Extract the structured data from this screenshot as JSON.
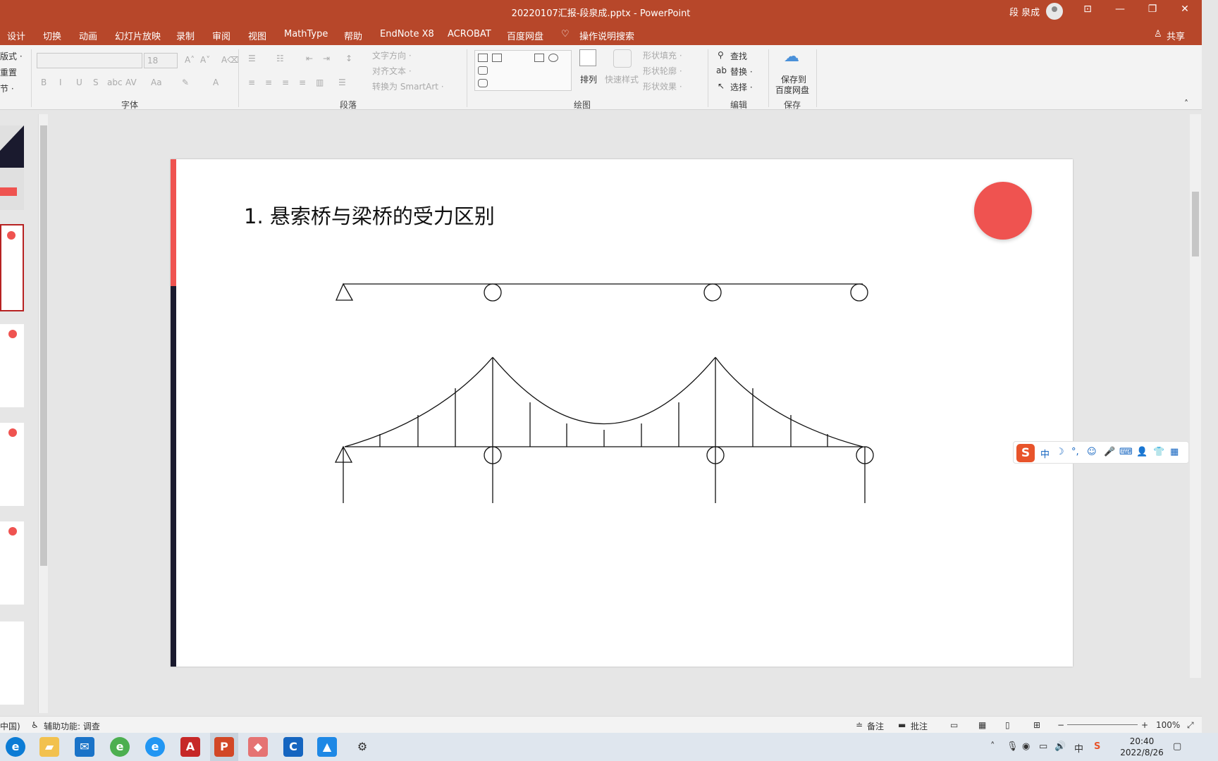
{
  "window": {
    "title": "20220107汇报-段泉成.pptx  -  PowerPoint",
    "user": "段 泉成",
    "controls": [
      "⊡",
      "—",
      "❐",
      "✕"
    ]
  },
  "tabs": [
    "设计",
    "切换",
    "动画",
    "幻灯片放映",
    "录制",
    "审阅",
    "视图",
    "MathType",
    "帮助",
    "EndNote X8",
    "ACROBAT",
    "百度网盘"
  ],
  "tell_me": "操作说明搜索",
  "share": "共享",
  "ribbon": {
    "left_partial": [
      "版式 ·",
      "重置",
      "节 ·"
    ],
    "font_size": "18",
    "groups": {
      "font": "字体",
      "paragraph": "段落",
      "drawing": "绘图",
      "editing": "编辑",
      "save": "保存"
    },
    "paragraph_items": [
      "文字方向 ·",
      "对齐文本 ·",
      "转换为 SmartArt ·"
    ],
    "drawing_items": {
      "arrange": "排列",
      "quick_styles": "快速样式",
      "shape_fill": "形状填充 ·",
      "shape_outline": "形状轮廓 ·",
      "shape_effects": "形状效果 ·"
    },
    "editing_items": [
      "查找",
      "替换 ·",
      "选择 ·"
    ],
    "save_items": [
      "保存到",
      "百度网盘"
    ],
    "font_buttons": [
      "B",
      "I",
      "U",
      "S",
      "abc",
      "AV",
      "Aa",
      "A"
    ]
  },
  "slide": {
    "heading": "1. 悬索桥与梁桥的受力区别"
  },
  "ime": {
    "logo": "S",
    "items": [
      "中",
      "☽",
      "°,",
      "☺",
      "🎤",
      "⌨",
      "👤",
      "👕",
      "▦"
    ]
  },
  "statusbar": {
    "language": "中国)",
    "accessibility": "辅助功能: 调查",
    "notes": "备注",
    "comments": "批注",
    "zoom": "100%"
  },
  "taskbar": {
    "time": "20:40",
    "date": "2022/8/26",
    "tray_lang": "中"
  },
  "colors": {
    "accent": "#b7472a",
    "slide_red": "#ef5350",
    "slide_dark": "#1a1a2e"
  }
}
